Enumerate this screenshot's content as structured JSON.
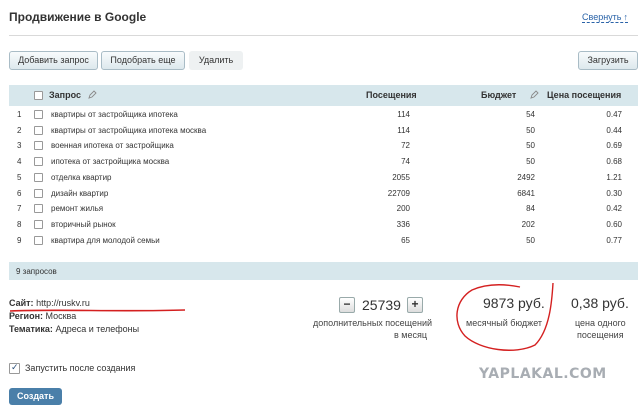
{
  "header": {
    "title": "Продвижение в Google",
    "collapse_label": "Свернуть",
    "collapse_arrow": "↑"
  },
  "toolbar": {
    "add_label": "Добавить запрос",
    "pick_label": "Подобрать еще",
    "delete_label": "Удалить",
    "upload_label": "Загрузить"
  },
  "table": {
    "columns": {
      "query": "Запрос",
      "visits": "Посещения",
      "budget": "Бюджет",
      "price": "Цена посещения",
      "edit_icon": "pencil-icon"
    },
    "rows": [
      {
        "n": "1",
        "query": "квартиры от застройщика ипотека",
        "visits": "114",
        "budget": "54",
        "price": "0.47"
      },
      {
        "n": "2",
        "query": "квартиры от застройщика ипотека москва",
        "visits": "114",
        "budget": "50",
        "price": "0.44"
      },
      {
        "n": "3",
        "query": "военная ипотека от застройщика",
        "visits": "72",
        "budget": "50",
        "price": "0.69"
      },
      {
        "n": "4",
        "query": "ипотека от застройщика москва",
        "visits": "74",
        "budget": "50",
        "price": "0.68"
      },
      {
        "n": "5",
        "query": "отделка квартир",
        "visits": "2055",
        "budget": "2492",
        "price": "1.21"
      },
      {
        "n": "6",
        "query": "дизайн квартир",
        "visits": "22709",
        "budget": "6841",
        "price": "0.30"
      },
      {
        "n": "7",
        "query": "ремонт жилья",
        "visits": "200",
        "budget": "84",
        "price": "0.42"
      },
      {
        "n": "8",
        "query": "вторичный рынок",
        "visits": "336",
        "budget": "202",
        "price": "0.60"
      },
      {
        "n": "9",
        "query": "квартира для молодой семьи",
        "visits": "65",
        "budget": "50",
        "price": "0.77"
      }
    ],
    "footer": "9 запросов"
  },
  "info": {
    "site_label": "Сайт:",
    "site_value": "http://ruskv.ru",
    "region_label": "Регион:",
    "region_value": "Москва",
    "topic_label": "Тематика:",
    "topic_value": "Адреса и телефоны"
  },
  "stats": {
    "minus": "−",
    "plus": "+",
    "visits_value": "25739",
    "visits_caption_1": "дополнительных посещений",
    "visits_caption_2": "в месяц",
    "budget_value": "9873 руб.",
    "budget_caption": "месячный бюджет",
    "price_value": "0,38 руб.",
    "price_caption_1": "цена одного",
    "price_caption_2": "посещения"
  },
  "options": {
    "autostart_label": "Запустить после создания",
    "autostart_checked": true,
    "check_mark": "✓"
  },
  "create_label": "Создать",
  "watermark": "YAPLAKAL.COM",
  "colors": {
    "table_header": "#d7e7ec",
    "link": "#2a63a8",
    "create_button": "#4a7fa9",
    "annotation": "#d42020"
  }
}
